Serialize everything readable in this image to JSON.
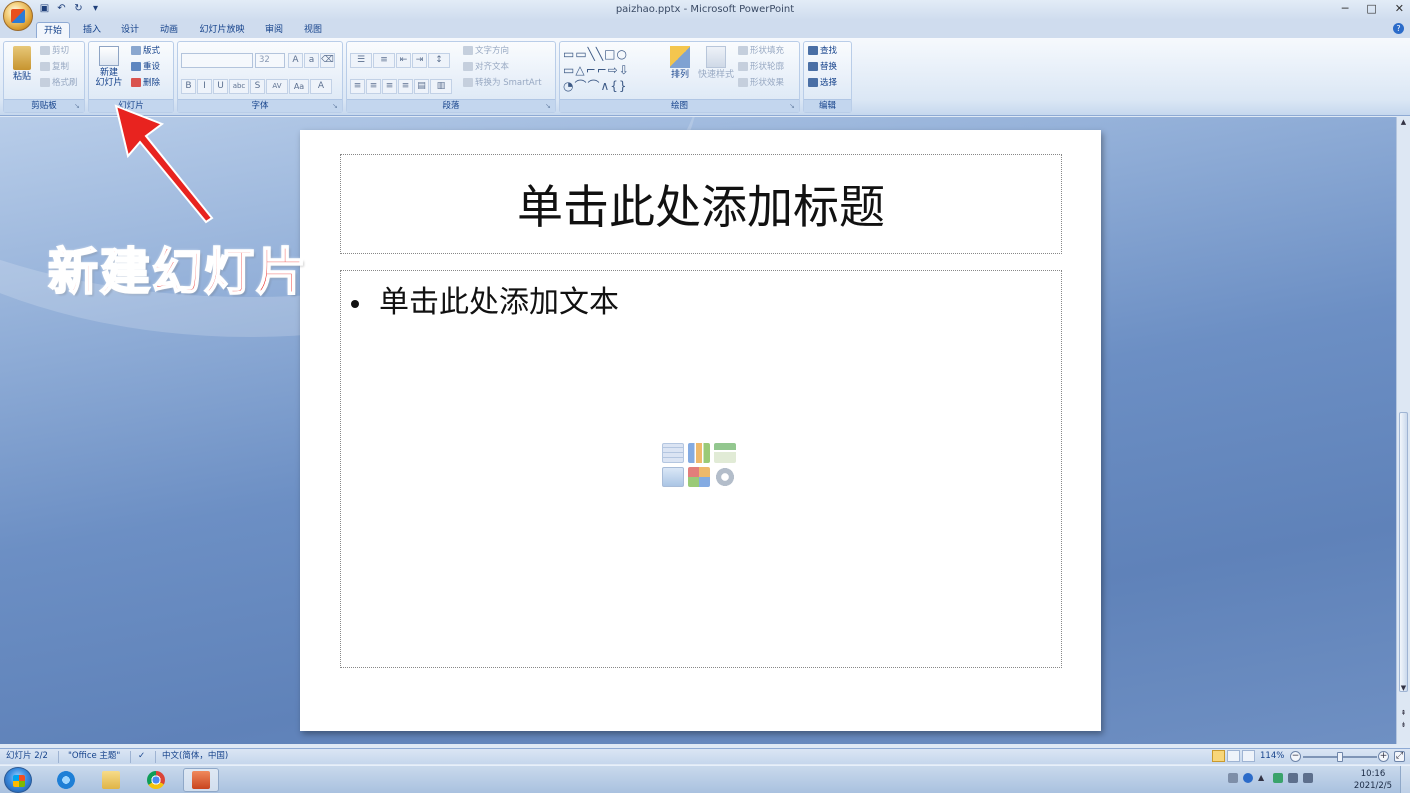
{
  "window": {
    "title": "paizhao.pptx - Microsoft PowerPoint",
    "minimize": "─",
    "restore": "□",
    "close": "✕"
  },
  "tabs": [
    {
      "label": "开始",
      "active": true
    },
    {
      "label": "插入"
    },
    {
      "label": "设计"
    },
    {
      "label": "动画"
    },
    {
      "label": "幻灯片放映"
    },
    {
      "label": "审阅"
    },
    {
      "label": "视图"
    }
  ],
  "ribbon": {
    "clipboard": {
      "group_label": "剪贴板",
      "paste": "粘贴",
      "cut": "剪切",
      "copy": "复制",
      "format_painter": "格式刷"
    },
    "slides": {
      "group_label": "幻灯片",
      "new_slide_line1": "新建",
      "new_slide_line2": "幻灯片",
      "layout": "版式",
      "reset": "重设",
      "delete": "删除"
    },
    "font": {
      "group_label": "字体",
      "font_name": "",
      "font_size": "32",
      "bold": "B",
      "italic": "I",
      "underline": "U",
      "strike": "abc",
      "shadow": "S",
      "spacing": "AV",
      "case": "Aa",
      "color": "A"
    },
    "paragraph": {
      "group_label": "段落",
      "text_direction": "文字方向",
      "align_text": "对齐文本",
      "convert_smartart": "转换为 SmartArt"
    },
    "drawing": {
      "group_label": "绘图",
      "arrange": "排列",
      "quick_styles": "快速样式",
      "shape_fill": "形状填充",
      "shape_outline": "形状轮廓",
      "shape_effects": "形状效果"
    },
    "editing": {
      "group_label": "编辑",
      "find": "查找",
      "replace": "替换",
      "select": "选择"
    }
  },
  "slide": {
    "title_placeholder": "单击此处添加标题",
    "body_placeholder": "单击此处添加文本"
  },
  "annotation": {
    "text": "新建幻灯片",
    "color": "#e8231f"
  },
  "statusbar": {
    "slide_indicator": "幻灯片 2/2",
    "theme": "\"Office 主题\"",
    "language": "中文(简体，中国)",
    "zoom": "114%"
  },
  "taskbar": {
    "time": "10:16",
    "date": "2021/2/5"
  },
  "colors": {
    "accent": "#15428b",
    "workspace": "#6c8fc4",
    "ribbon": "#dbe7f5"
  }
}
